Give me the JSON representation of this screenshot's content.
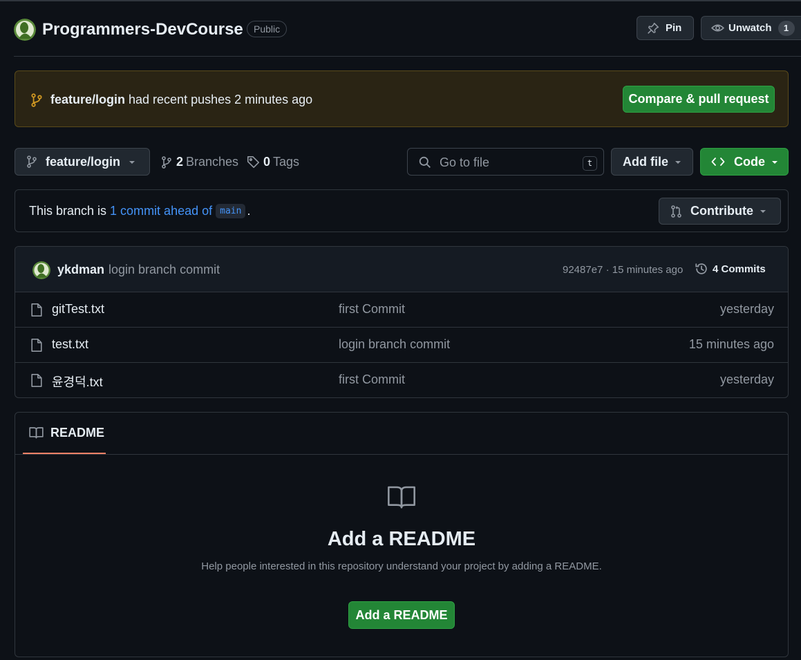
{
  "repo": {
    "name": "Programmers-DevCourse",
    "visibility": "Public",
    "pin_label": "Pin",
    "unwatch_label": "Unwatch",
    "watch_count": "1"
  },
  "push_banner": {
    "branch": "feature/login",
    "text": " had recent pushes 2 minutes ago",
    "button_label": "Compare & pull request"
  },
  "toolbar": {
    "branch_label": "feature/login",
    "branches_count": "2",
    "branches_label": "Branches",
    "tags_count": "0",
    "tags_label": "Tags",
    "search_placeholder": "Go to file",
    "search_shortcut": "t",
    "add_file_label": "Add file",
    "code_label": "Code"
  },
  "ahead": {
    "prefix": "This branch is ",
    "link_text": "1 commit ahead of",
    "base_branch": "main",
    "suffix": ".",
    "contribute_label": "Contribute"
  },
  "latest_commit": {
    "author": "ykdman",
    "message": "login branch commit",
    "meta": "92487e7 · 15 minutes ago",
    "commits_label": "4 Commits"
  },
  "files": [
    {
      "name": "gitTest.txt",
      "commit": "first Commit",
      "time": "yesterday"
    },
    {
      "name": "test.txt",
      "commit": "login branch commit",
      "time": "15 minutes ago"
    },
    {
      "name": "윤경덕.txt",
      "commit": "first Commit",
      "time": "yesterday"
    }
  ],
  "readme": {
    "tab_label": "README",
    "heading": "Add a README",
    "subtext": "Help people interested in this repository understand your project by adding a README.",
    "button_label": "Add a README"
  },
  "colors": {
    "background": "#0d1117",
    "border": "#30363d",
    "accent_green": "#238636",
    "link_blue": "#4493f8",
    "banner_bg": "#2a2414",
    "tab_underline": "#f78166"
  }
}
